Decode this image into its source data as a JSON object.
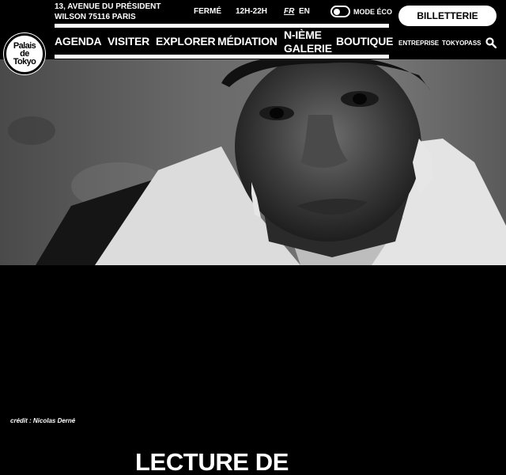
{
  "site": {
    "logo_lines": [
      "Palais",
      "de",
      "Tokyo"
    ]
  },
  "header": {
    "address_line1": "13, AVENUE DU PRÉSIDENT",
    "address_line2": "WILSON 75116 PARIS",
    "status": "FERMÉ",
    "hours": "12H-22H",
    "lang_fr": "FR",
    "lang_en": "EN",
    "eco_label": "MODE ÉCO",
    "eco_enabled": false,
    "ticket_label": "BILLETTERIE"
  },
  "nav": {
    "agenda": "AGENDA",
    "visiter": "VISITER",
    "explorer": "EXPLORER",
    "mediation": "MÉDIATION",
    "galerie_line1": "N-IÈME",
    "galerie_line2": "GALERIE",
    "boutique": "BOUTIQUE"
  },
  "secondary_nav": {
    "entreprise": "ENTREPRISE",
    "tokyopass": "TOKYOPASS"
  },
  "icons": {
    "search": "search-icon"
  },
  "hero": {
    "credit": "crédit : Nicolas Derné"
  },
  "page": {
    "title": "LECTURE DE"
  },
  "colors": {
    "background": "#000000",
    "foreground": "#ffffff"
  }
}
